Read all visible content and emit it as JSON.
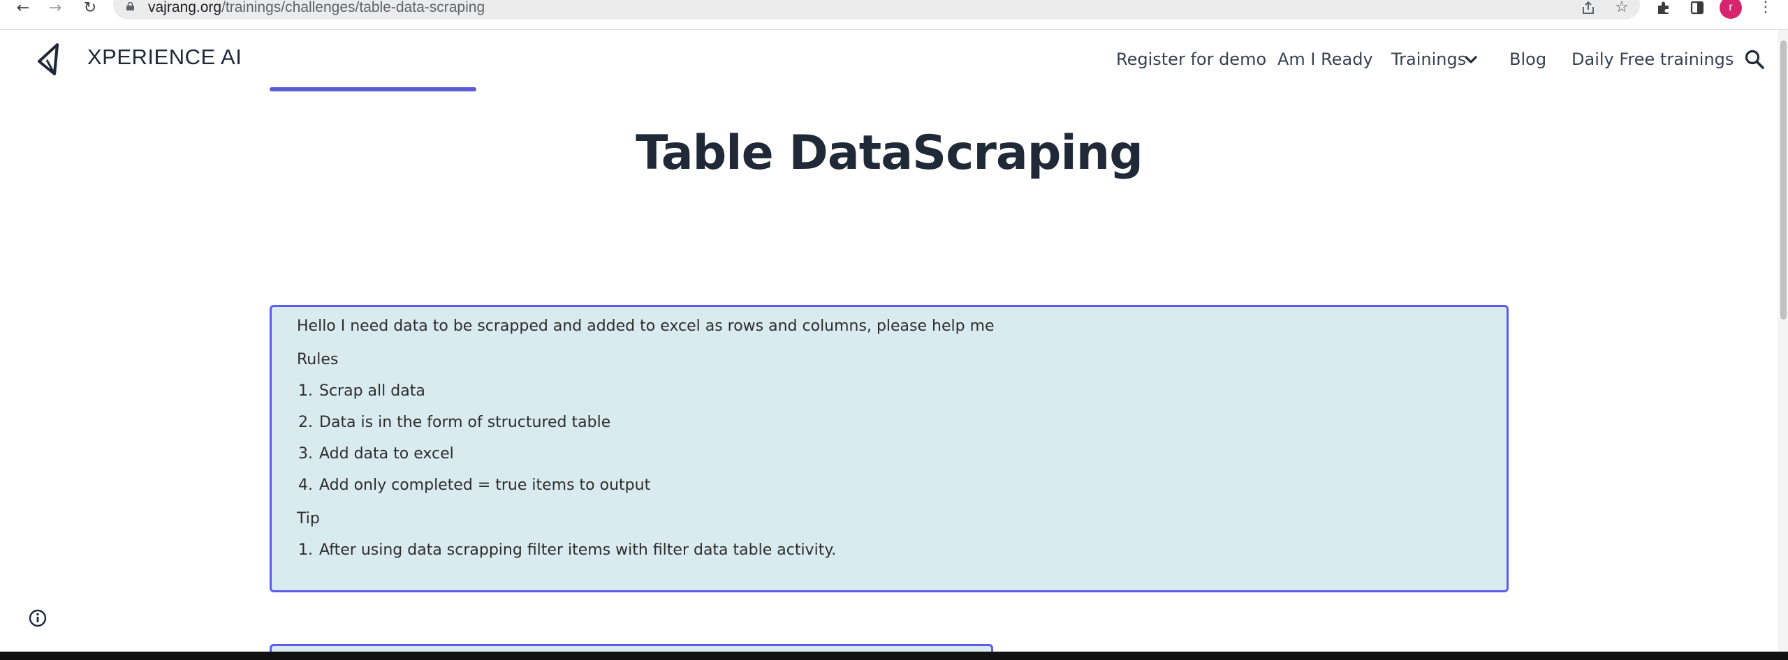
{
  "browser": {
    "url_domain": "vajrang.org",
    "url_path": "/trainings/challenges/table-data-scraping",
    "profile_initial": "r",
    "icons": [
      "back-icon",
      "forward-icon",
      "reload-icon",
      "lock-icon",
      "share-icon",
      "bookmark-star-icon",
      "extensions-puzzle-icon",
      "side-panel-icon",
      "menu-kebab-icon"
    ]
  },
  "header": {
    "brand": "XPERIENCE AI",
    "nav": {
      "register": "Register for demo",
      "ready": "Am I Ready",
      "trainings": "Trainings",
      "blog": "Blog",
      "daily": "Daily Free trainings"
    },
    "accent_color": "#5b5bd6"
  },
  "main": {
    "title": "Table DataScraping",
    "instructions": {
      "intro": "Hello I need data to be scrapped and added to excel as rows and columns, please help me",
      "rules_heading": "Rules",
      "rules": [
        {
          "num": "1.",
          "text": "Scrap all data"
        },
        {
          "num": "2.",
          "text": "Data is in the form of structured table"
        },
        {
          "num": "3.",
          "text": "Add data to excel"
        },
        {
          "num": "4.",
          "text": "Add only completed = true items to output"
        }
      ],
      "tip_heading": "Tip",
      "tips": [
        {
          "num": "1.",
          "text": "After using data scrapping filter items with filter data table activity."
        }
      ],
      "box_color": "#daebf0",
      "border_color": "#5b5bf0"
    }
  }
}
